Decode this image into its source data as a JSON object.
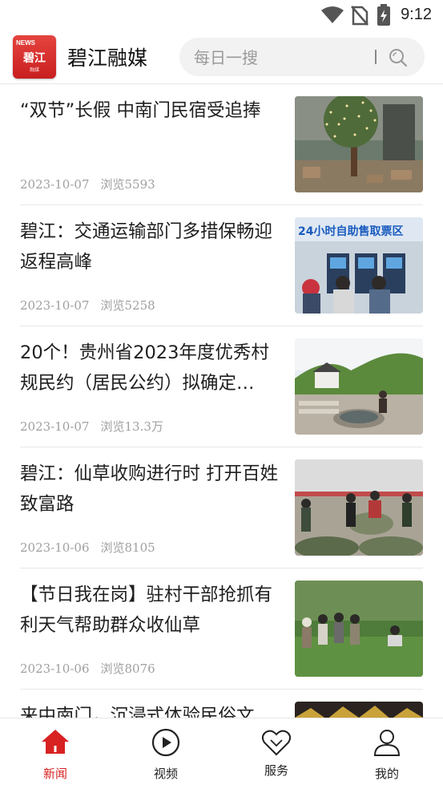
{
  "status_bar": {
    "time": "9:12"
  },
  "header": {
    "logo": {
      "badge": "NEWS",
      "name": "碧江",
      "sub": "融媒"
    },
    "title": "碧江融媒",
    "search_placeholder": "每日一搜"
  },
  "articles": [
    {
      "title": "“双节”长假 中南门民宿受追捧",
      "date": "2023-10-07",
      "views": "浏览5593",
      "thumb": "courtyard-tree-lights"
    },
    {
      "title": "碧江：交通运输部门多措保畅迎返程高峰",
      "date": "2023-10-07",
      "views": "浏览5258",
      "thumb": "ticket-machines",
      "thumb_sign": "24小时自助售取票区"
    },
    {
      "title": "20个！贵州省2023年度优秀村规民约（居民公约）拟确定…",
      "date": "2023-10-07",
      "views": "浏览13.3万",
      "thumb": "village-well"
    },
    {
      "title": "碧江：仙草收购进行时 打开百姓致富路",
      "date": "2023-10-06",
      "views": "浏览8105",
      "thumb": "herb-sacks"
    },
    {
      "title": "【节日我在岗】驻村干部抢抓有利天气帮助群众收仙草",
      "date": "2023-10-06",
      "views": "浏览8076",
      "thumb": "field-harvest"
    },
    {
      "title": "来中南门，沉浸式体验民俗文",
      "date": "",
      "views": "",
      "thumb": "festival-roof"
    }
  ],
  "nav": [
    {
      "label": "新闻",
      "icon": "home-icon",
      "active": true
    },
    {
      "label": "视频",
      "icon": "play-icon",
      "active": false
    },
    {
      "label": "服务",
      "icon": "heart-icon",
      "active": false
    },
    {
      "label": "我的",
      "icon": "user-icon",
      "active": false
    }
  ],
  "colors": {
    "accent": "#d82222",
    "meta": "#a0a0a0",
    "divider": "#e8e8e8"
  }
}
